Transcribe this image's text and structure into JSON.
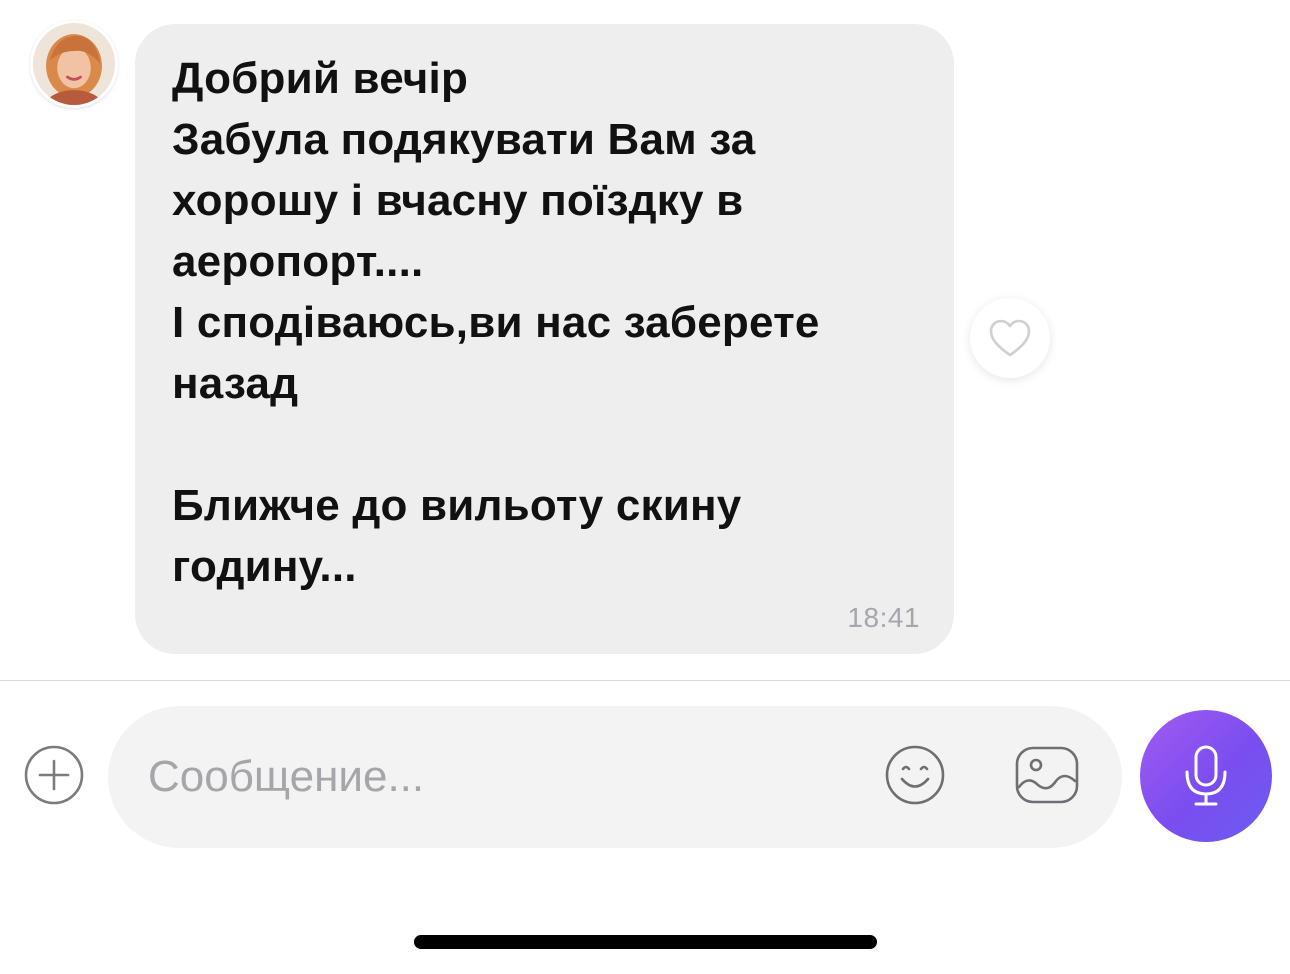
{
  "chat": {
    "message": {
      "text": "Добрий вечір\nЗабула подякувати Вам за\nхорошу і вчасну поїздку в\nаеропорт....\nІ сподіваюсь,ви нас заберете\nназад\n\nБлижче до вильоту скину\nгодину...",
      "time": "18:41",
      "avatar_icon": "contact-avatar"
    },
    "like_icon": "heart-outline-icon"
  },
  "composer": {
    "placeholder": "Сообщение...",
    "add_icon": "plus-circle-icon",
    "emoji_icon": "smiley-icon",
    "gallery_icon": "image-icon",
    "mic_icon": "microphone-icon"
  },
  "colors": {
    "bubble": "#eeeeef",
    "accent_from": "#a35bf0",
    "accent_to": "#6d5cf2"
  }
}
